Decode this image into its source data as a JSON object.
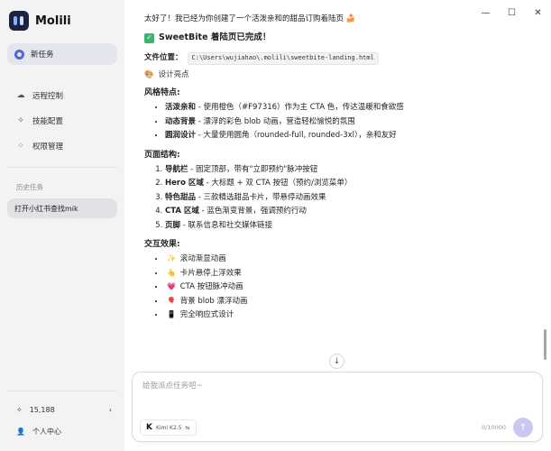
{
  "app": {
    "name": "Molili"
  },
  "sidebar": {
    "new_task": "新任务",
    "items": [
      {
        "label": "远程控制",
        "icon": "cloud-icon"
      },
      {
        "label": "技能配置",
        "icon": "spark-icon"
      },
      {
        "label": "权限管理",
        "icon": "permissions-icon"
      }
    ],
    "history_label": "历史任务",
    "history": [
      {
        "label": "打开小红书查找mik"
      }
    ],
    "credits": "15,188",
    "user_center": "个人中心"
  },
  "message": {
    "intro": "太好了！我已经为你创建了一个活泼亲和的甜品订购着陆页 🍰",
    "done_title": "SweetBite 着陆页已完成！",
    "file_label": "文件位置：",
    "file_path": "C:\\Users\\wujiahao\\.molili\\sweetbite-landing.html",
    "design_highlights": "设计亮点",
    "style_heading": "风格特点:",
    "style_items": [
      {
        "title": "活泼亲和",
        "desc": " - 使用橙色（#F97316）作为主 CTA 色，传达温暖和食欲感"
      },
      {
        "title": "动态背景",
        "desc": " - 漂浮的彩色 blob 动画，营造轻松愉悦的氛围"
      },
      {
        "title": "圆润设计",
        "desc": " - 大量使用圆角（rounded-full, rounded-3xl），亲和友好"
      }
    ],
    "structure_heading": "页面结构:",
    "structure_items": [
      {
        "title": "导航栏",
        "desc": " - 固定顶部，带有\"立即预约\"脉冲按钮"
      },
      {
        "title": "Hero 区域",
        "desc": " - 大标题 + 双 CTA 按钮（预约/浏览菜单）"
      },
      {
        "title": "特色甜品",
        "desc": " - 三款精选甜品卡片，带悬停动画效果"
      },
      {
        "title": "CTA 区域",
        "desc": " - 蓝色渐变背景，强调预约行动"
      },
      {
        "title": "页脚",
        "desc": " - 联系信息和社交媒体链接"
      }
    ],
    "interaction_heading": "交互效果:",
    "interaction_items": [
      {
        "emoji": "✨",
        "text": "滚动渐显动画"
      },
      {
        "emoji": "👆",
        "text": "卡片悬停上浮效果"
      },
      {
        "emoji": "💗",
        "text": "CTA 按钮脉冲动画"
      },
      {
        "emoji": "🎈",
        "text": "背景 blob 漂浮动画"
      },
      {
        "emoji": "📱",
        "text": "完全响应式设计"
      }
    ]
  },
  "composer": {
    "placeholder": "给我派点任务吧~",
    "model": "Kimi K2.5",
    "counter": "0/10000"
  },
  "colors": {
    "accent": "#5566d8",
    "success": "#3cb371",
    "send": "#c9c9f0"
  }
}
